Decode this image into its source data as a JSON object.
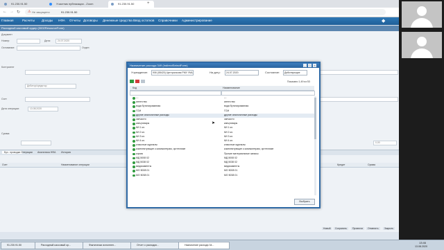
{
  "browser": {
    "tabs": [
      {
        "title": "91.230.91.50"
      },
      {
        "title": "Участник публикации - Zoom"
      },
      {
        "title": "91.230.91.50"
      }
    ],
    "security_label": "Не защищено",
    "url": "91.230.91.50"
  },
  "app": {
    "nav_items": [
      "Главная",
      "Расчеты",
      "Доходы",
      "НФА",
      "Отчеты",
      "Договоры",
      "Денежные средства",
      "Ввод остатков",
      "Справочники",
      "Администрирование"
    ],
    "subheader": "Расходный кассовый ордер (3002ResourceForm)",
    "form_labels": [
      "Документ",
      "Номер:",
      "Дата:",
      "Основание:",
      "Отдел:",
      "Контрагент",
      "Счет",
      "Дата операции:",
      "Сумма:",
      "Операции",
      "Комментарий"
    ],
    "form_values": [
      "24.07.2020",
      "Дебитор/кредитор",
      "13.08.2020",
      "0,00"
    ],
    "bottom_tabs": [
      "Бух. проводки",
      "Операции",
      "Аналитика НФА",
      "История"
    ],
    "table_headers": [
      "Счет",
      "Наименование операции",
      "Кредит",
      "Сумма"
    ],
    "bottom_right": [
      "Новый",
      "Сохранить",
      "Провести",
      "Отменить",
      "Закрыть"
    ]
  },
  "modal": {
    "title": "Назначение расхода 349 (IndirectSelectForm)",
    "institution_label": "Учреждение:",
    "institution_value": "906 (08420) Центральная РМУ УМЦ",
    "date_label": "На дату:",
    "date_value": "24.07.2020",
    "status_label": "Состояние:",
    "status_value": "Действующие",
    "shown": "Показано 1-49 из 53",
    "col_code": "Код",
    "col_name": "Наименование",
    "rows": [
      {
        "code": "---",
        "name": "---"
      },
      {
        "code": "агентство",
        "name": "агентство"
      },
      {
        "code": "вода бутилированная",
        "name": "вода бутилированная"
      },
      {
        "code": "ГСМ",
        "name": "ГСМ"
      },
      {
        "code": "другие аналогичные расходы",
        "name": "другие аналогичные расходы"
      },
      {
        "code": "запчасти",
        "name": "запчасти"
      },
      {
        "code": "канцтовары",
        "name": "канцтовары"
      },
      {
        "code": "КИ 1 кл.",
        "name": "КИ 1 кл."
      },
      {
        "code": "КИ 2 кл.",
        "name": "КИ 2 кл."
      },
      {
        "code": "КИ 3 кл.",
        "name": "КИ 3 кл."
      },
      {
        "code": "КИ 4 кл.",
        "name": "КИ 4 кл."
      },
      {
        "code": "классные журналы",
        "name": "классные журналы"
      },
      {
        "code": "комплектующие к компьютерам, оргтехнике",
        "name": "комплектующие к компьютерам, оргтехнике"
      },
      {
        "code": "корма",
        "name": "Прочие материальные запасы"
      },
      {
        "code": "МД 5008 02",
        "name": "МД 5008 02"
      },
      {
        "code": "МД 5038 02",
        "name": "МД 5038 02"
      },
      {
        "code": "медикаменты",
        "name": "медикаменты"
      },
      {
        "code": "МО 5008 01",
        "name": "МО 5008 01"
      },
      {
        "code": "МО 5038 01",
        "name": "МО 5038 01"
      }
    ],
    "select_button": "Выбрать"
  },
  "taskbar": {
    "items": [
      "91.230.91.50",
      "Расходный кассовый ор...",
      "Фактически исполнен...",
      "Отчет о расходах...",
      "Назначение расхода 34..."
    ],
    "clock_time": "13:46",
    "clock_date": "13.08.2020"
  },
  "colors": {
    "accent": "#2f6aa6",
    "nav_bg": "#1f5f98",
    "icon_green": "#2f9a3e"
  }
}
